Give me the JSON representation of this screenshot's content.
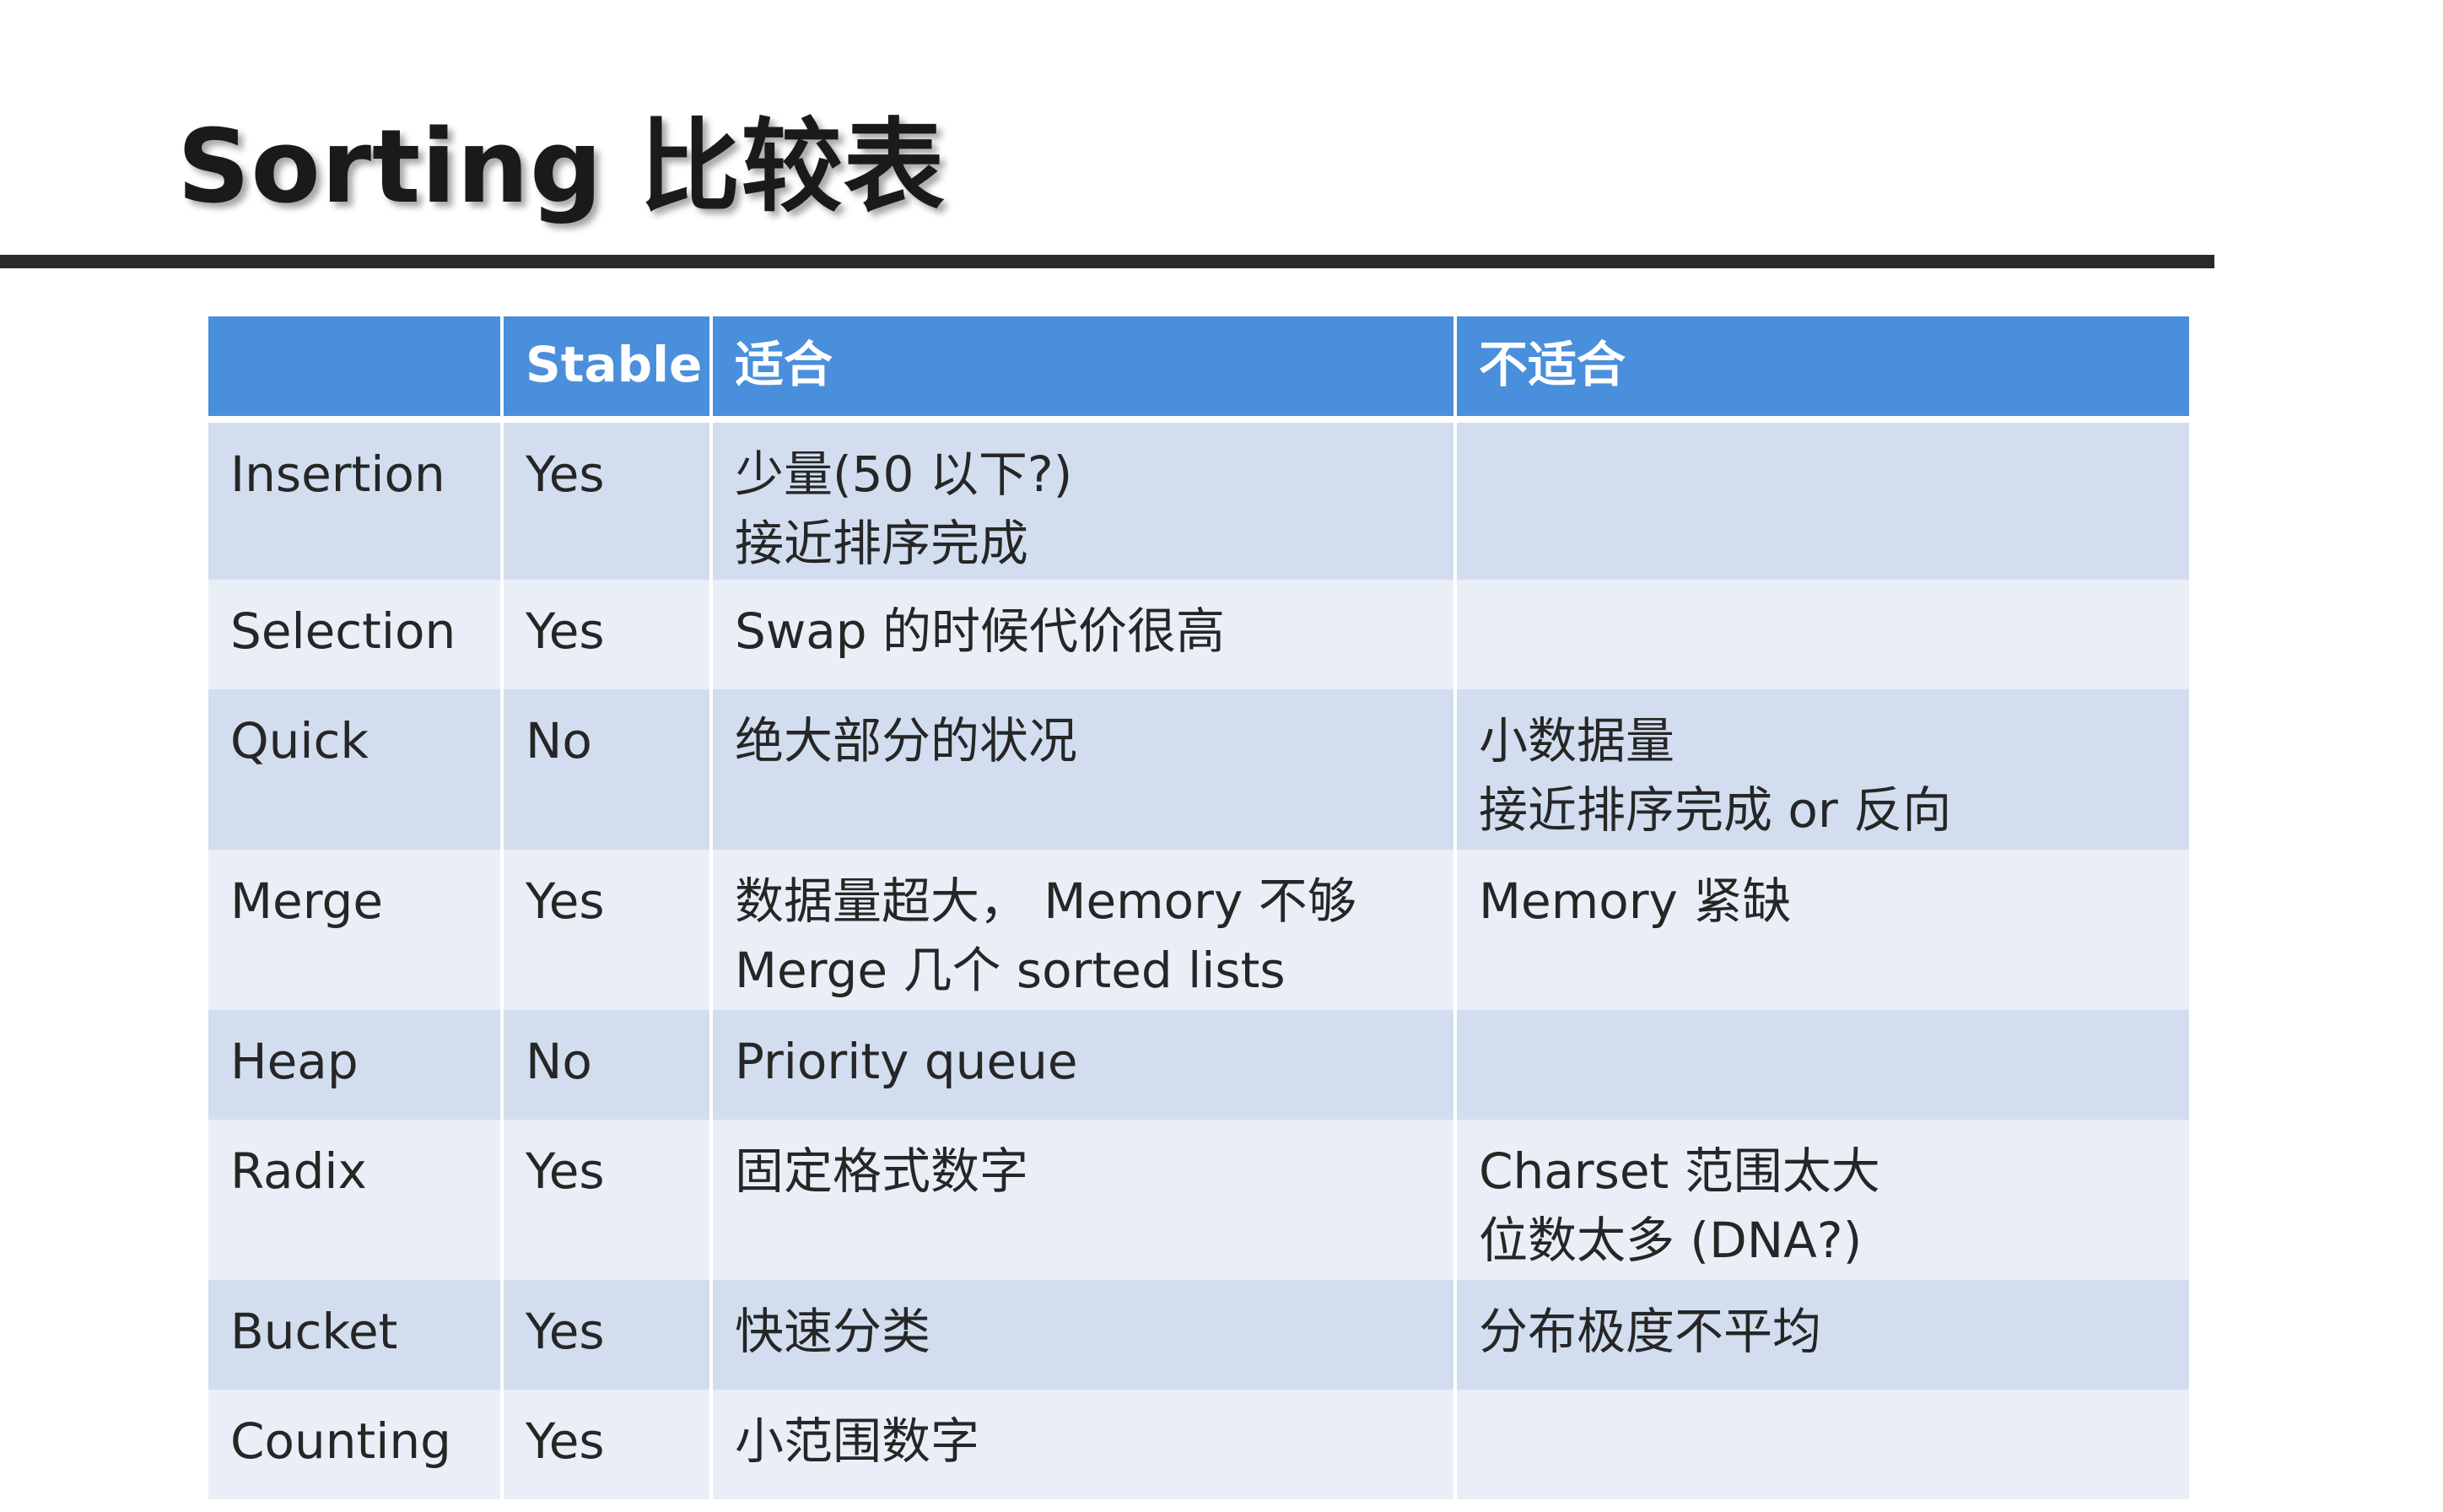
{
  "title": "Sorting 比较表",
  "table": {
    "headers": [
      "",
      "Stable",
      "适合",
      "不适合"
    ],
    "rows": [
      {
        "name": "Insertion",
        "stable": "Yes",
        "suitable": [
          "少量(50 以下?)",
          "接近排序完成"
        ],
        "unsuitable": []
      },
      {
        "name": "Selection",
        "stable": "Yes",
        "suitable": [
          "Swap 的时候代价很高"
        ],
        "unsuitable": []
      },
      {
        "name": "Quick",
        "stable": "No",
        "suitable": [
          "绝大部分的状况"
        ],
        "unsuitable": [
          "小数据量",
          "接近排序完成 or 反向"
        ]
      },
      {
        "name": "Merge",
        "stable": "Yes",
        "suitable": [
          "数据量超大， Memory 不够",
          "Merge 几个 sorted lists"
        ],
        "unsuitable": [
          "Memory 紧缺"
        ]
      },
      {
        "name": "Heap",
        "stable": "No",
        "suitable": [
          "Priority queue"
        ],
        "unsuitable": []
      },
      {
        "name": "Radix",
        "stable": "Yes",
        "suitable": [
          "固定格式数字"
        ],
        "unsuitable": [
          "Charset 范围太大",
          "位数太多 (DNA?)"
        ]
      },
      {
        "name": "Bucket",
        "stable": "Yes",
        "suitable": [
          "快速分类"
        ],
        "unsuitable": [
          "分布极度不平均"
        ]
      },
      {
        "name": "Counting",
        "stable": "Yes",
        "suitable": [
          "小范围数字"
        ],
        "unsuitable": []
      }
    ]
  },
  "colors": {
    "header_bg": "#4a8fdb",
    "row_odd_bg": "#d2deef",
    "row_even_bg": "#eaeff7"
  }
}
